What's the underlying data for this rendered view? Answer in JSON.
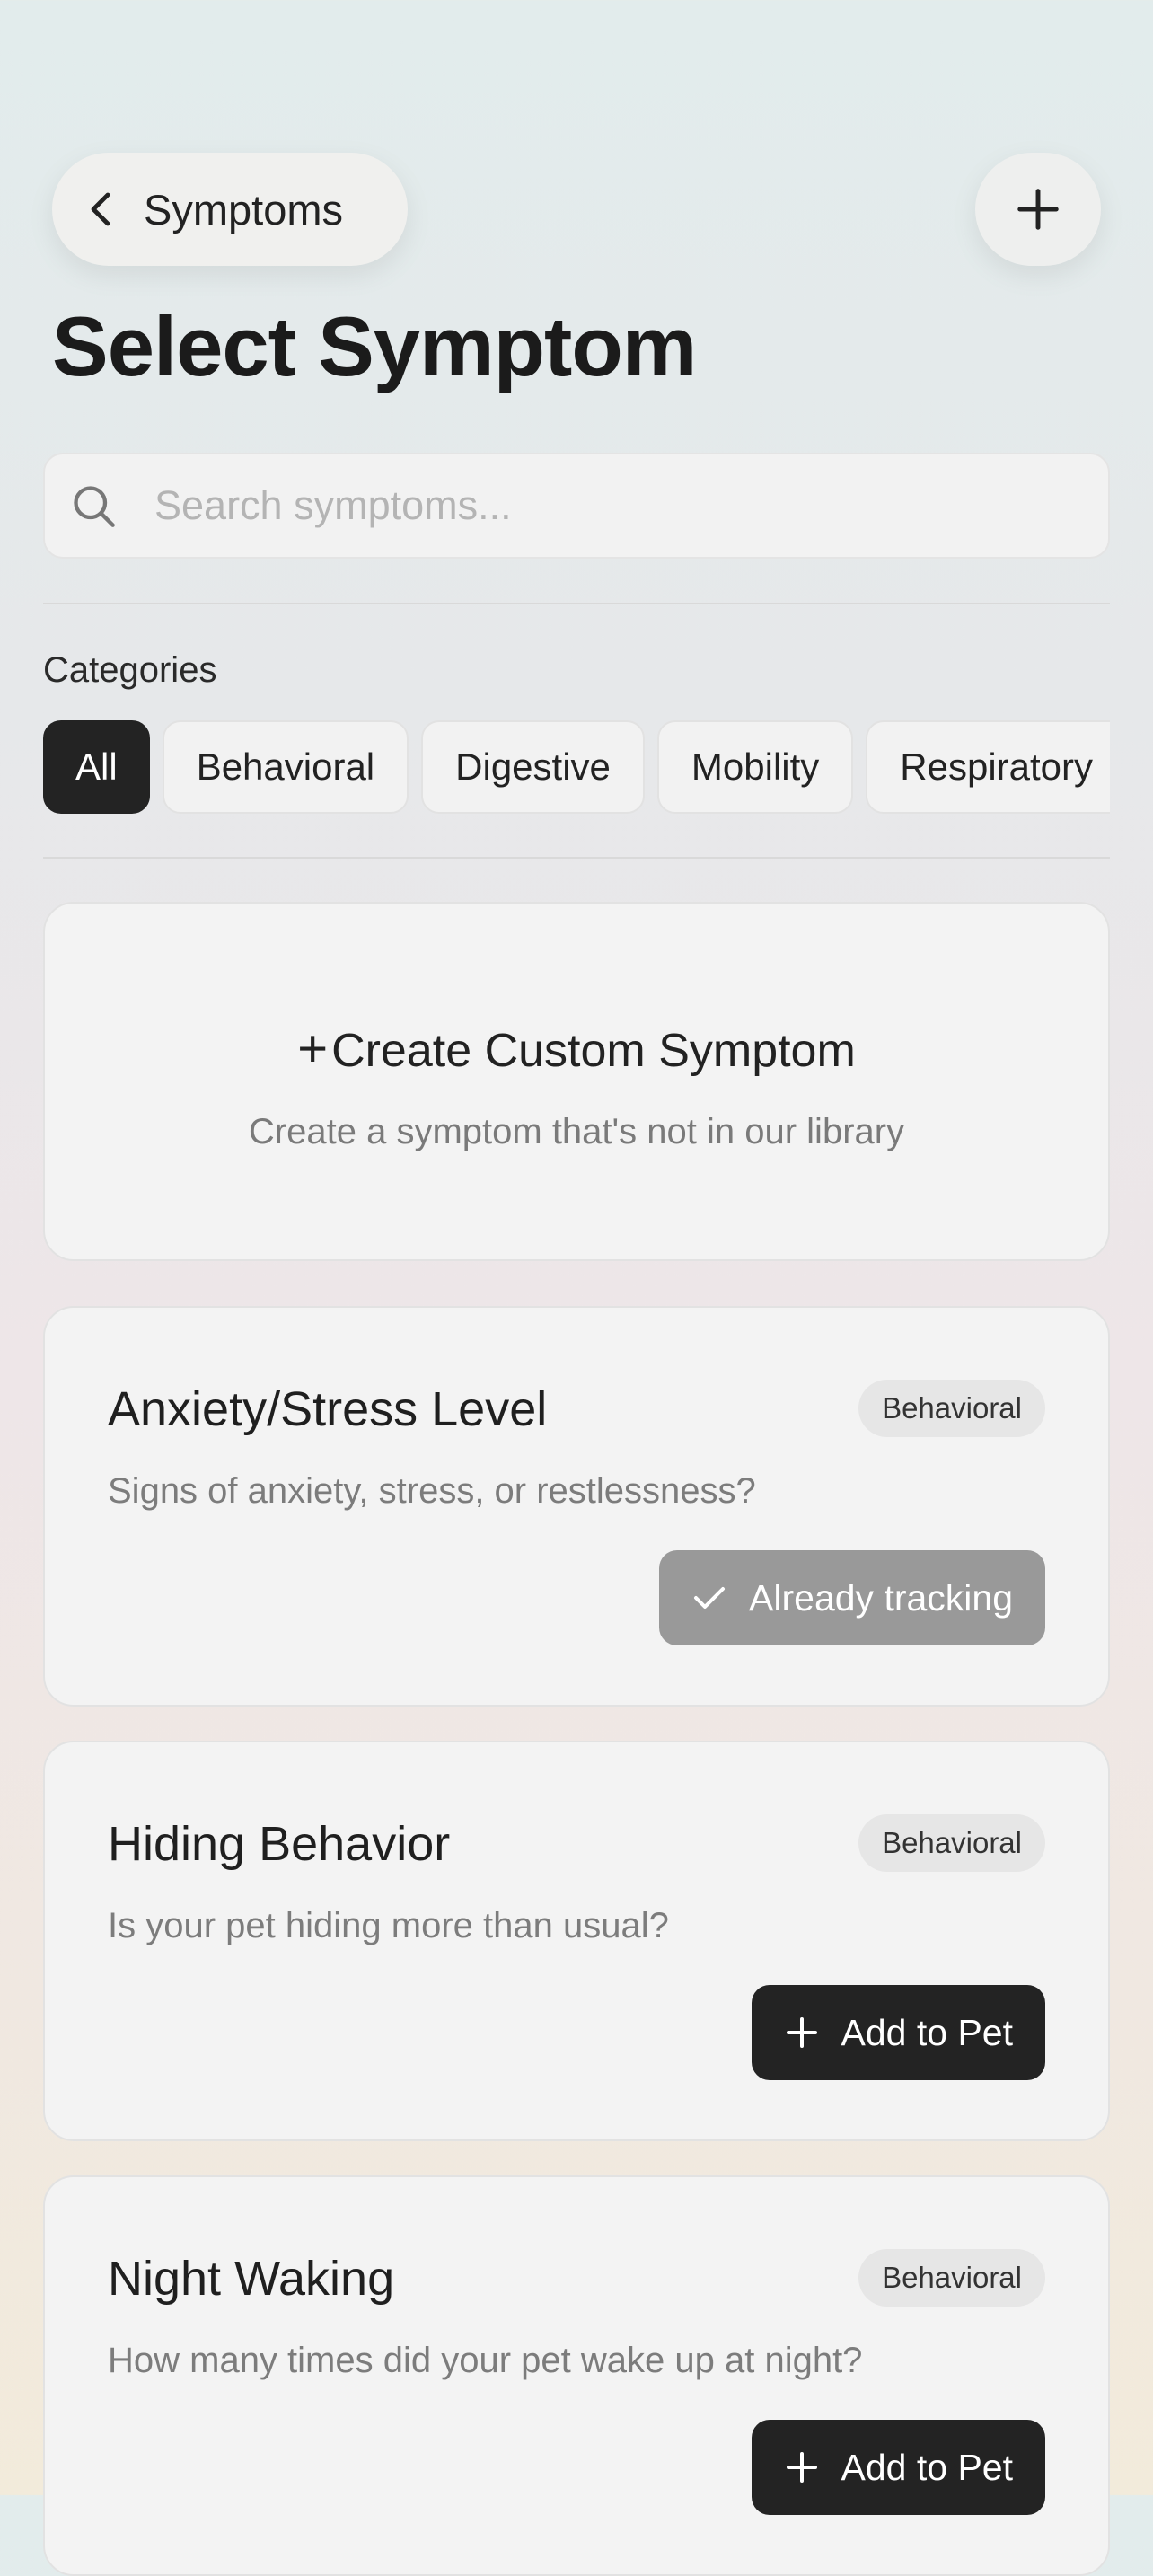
{
  "header": {
    "back_label": "Symptoms",
    "title": "Select Symptom"
  },
  "search": {
    "placeholder": "Search symptoms...",
    "value": ""
  },
  "categories": {
    "heading": "Categories",
    "items": [
      "All",
      "Behavioral",
      "Digestive",
      "Mobility",
      "Respiratory"
    ],
    "selected": "All"
  },
  "custom": {
    "title": "Create Custom Symptom",
    "subtitle": "Create a symptom that's not in our library"
  },
  "symptoms": [
    {
      "name": "Anxiety/Stress Level",
      "category": "Behavioral",
      "description": "Signs of anxiety, stress, or restlessness?",
      "action": "Already tracking"
    },
    {
      "name": "Hiding Behavior",
      "category": "Behavioral",
      "description": "Is your pet hiding more than usual?",
      "action": "Add to Pet"
    },
    {
      "name": "Night Waking",
      "category": "Behavioral",
      "description": "How many times did your pet wake up at night?",
      "action": "Add to Pet"
    }
  ],
  "colors": {
    "accent": "#232323",
    "tracking": "#999999"
  }
}
